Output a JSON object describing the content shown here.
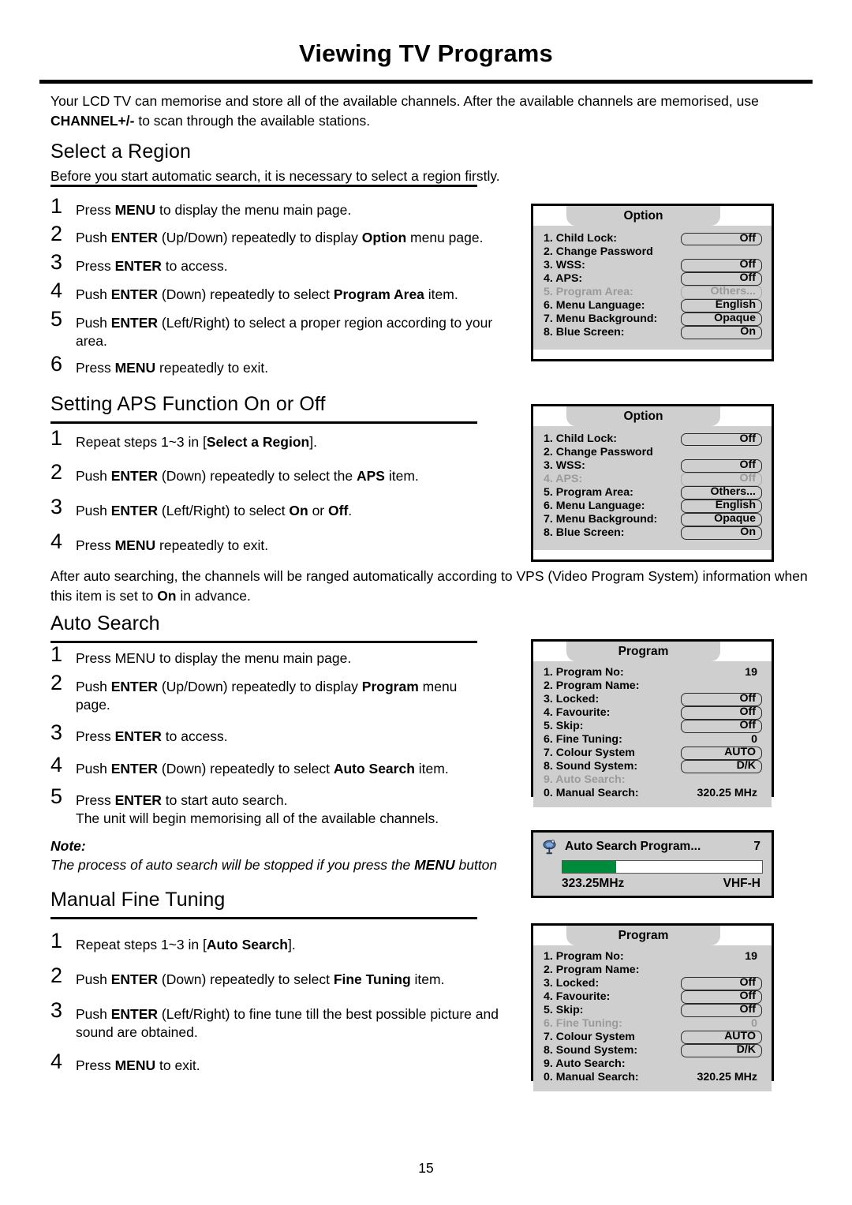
{
  "document": {
    "title": "Viewing TV Programs",
    "page_number": "15",
    "intro_html": "Your LCD TV can memorise and store all of the available channels. After the available channels are memorised, use <b>CHANNEL+/-</b> to scan through the available stations."
  },
  "sections": {
    "select_region": {
      "heading": "Select a Region",
      "subtitle": "Before you start automatic search, it is necessary to select a region firstly.",
      "steps": [
        {
          "num": "1",
          "html": "Press <b>MENU</b> to display the menu main page."
        },
        {
          "num": "2",
          "html": "Push <b>ENTER</b> (Up/Down)  repeatedly to display <b>Option</b> menu page."
        },
        {
          "num": "3",
          "html": "Press <b>ENTER</b> to access."
        },
        {
          "num": "4",
          "html": "Push <b>ENTER</b> (Down) repeatedly to select <b>Program Area</b> item."
        },
        {
          "num": "5",
          "html": "Push <b>ENTER</b> (Left/Right) to select a proper region according to your area."
        },
        {
          "num": "6",
          "html": "Press <b>MENU</b> repeatedly to exit."
        }
      ]
    },
    "aps": {
      "heading": "Setting APS Function On or Off",
      "steps": [
        {
          "num": "1",
          "html": "Repeat steps 1~3 in [<b>Select a Region</b>]."
        },
        {
          "num": "2",
          "html": "Push <b>ENTER</b> (Down) repeatedly to select the <b>APS</b> item."
        },
        {
          "num": "3",
          "html": "Push <b>ENTER</b> (Left/Right) to select <b>On</b> or <b>Off</b>."
        },
        {
          "num": "4",
          "html": "Press <b>MENU</b> repeatedly to exit."
        }
      ],
      "after_paragraph_html": "After auto searching, the channels will be ranged automatically according to VPS (Video Program System) information when this item is set to <b>On</b> in advance."
    },
    "auto_search": {
      "heading": "Auto Search",
      "steps": [
        {
          "num": "1",
          "html": "Press MENU to display the menu main page."
        },
        {
          "num": "2",
          "html": "Push <b>ENTER</b> (Up/Down) repeatedly to display <b>Program</b> menu page."
        },
        {
          "num": "3",
          "html": "Press <b>ENTER</b> to access."
        },
        {
          "num": "4",
          "html": "Push <b>ENTER</b> (Down) repeatedly to select <b>Auto Search</b> item."
        },
        {
          "num": "5",
          "html": "Press <b>ENTER</b> to start auto search.<br>The unit will begin memorising all of the available channels."
        }
      ],
      "note_label": "Note:",
      "note_html": "The process of auto search will be stopped if you press the <b>MENU</b> button"
    },
    "manual_fine_tuning": {
      "heading": "Manual Fine Tuning",
      "steps": [
        {
          "num": "1",
          "html": "Repeat steps 1~3 in [<b>Auto Search</b>]."
        },
        {
          "num": "2",
          "html": "Push <b>ENTER</b> (Down) repeatedly to select <b>Fine Tuning</b> item."
        },
        {
          "num": "3",
          "html": "Push <b>ENTER</b> (Left/Right) to fine tune till the best possible picture and sound are obtained."
        },
        {
          "num": "4",
          "html": "Press <b>MENU</b> to exit."
        }
      ]
    }
  },
  "osd": {
    "option_menu_1": {
      "title": "Option",
      "rows": [
        {
          "label": "1. Child Lock:",
          "value": "Off",
          "field": true,
          "dim": false
        },
        {
          "label": "2. Change Password",
          "value": "",
          "field": false,
          "dim": false
        },
        {
          "label": "3. WSS:",
          "value": "Off",
          "field": true,
          "dim": false
        },
        {
          "label": "4. APS:",
          "value": "Off",
          "field": true,
          "dim": false
        },
        {
          "label": "5. Program Area:",
          "value": "Others...",
          "field": true,
          "dim": true
        },
        {
          "label": "6. Menu Language:",
          "value": "English",
          "field": true,
          "dim": false
        },
        {
          "label": "7. Menu Background:",
          "value": "Opaque",
          "field": true,
          "dim": false
        },
        {
          "label": "8. Blue Screen:",
          "value": "On",
          "field": true,
          "dim": false
        }
      ]
    },
    "option_menu_2": {
      "title": "Option",
      "rows": [
        {
          "label": "1. Child Lock:",
          "value": "Off",
          "field": true,
          "dim": false
        },
        {
          "label": "2. Change Password",
          "value": "",
          "field": false,
          "dim": false
        },
        {
          "label": "3. WSS:",
          "value": "Off",
          "field": true,
          "dim": false
        },
        {
          "label": "4. APS:",
          "value": "Off",
          "field": true,
          "dim": true
        },
        {
          "label": "5. Program Area:",
          "value": "Others...",
          "field": true,
          "dim": false
        },
        {
          "label": "6. Menu Language:",
          "value": "English",
          "field": true,
          "dim": false
        },
        {
          "label": "7. Menu Background:",
          "value": "Opaque",
          "field": true,
          "dim": false
        },
        {
          "label": "8. Blue Screen:",
          "value": "On",
          "field": true,
          "dim": false
        }
      ]
    },
    "program_menu_1": {
      "title": "Program",
      "rows": [
        {
          "label": "1. Program No:",
          "value": "19",
          "field": false,
          "dim": false
        },
        {
          "label": "2. Program Name:",
          "value": "",
          "field": false,
          "dim": false
        },
        {
          "label": "3. Locked:",
          "value": "Off",
          "field": true,
          "dim": false
        },
        {
          "label": "4. Favourite:",
          "value": "Off",
          "field": true,
          "dim": false
        },
        {
          "label": "5. Skip:",
          "value": "Off",
          "field": true,
          "dim": false
        },
        {
          "label": "6. Fine Tuning:",
          "value": "0",
          "field": false,
          "dim": false
        },
        {
          "label": "7. Colour System",
          "value": "AUTO",
          "field": true,
          "dim": false
        },
        {
          "label": "8. Sound System:",
          "value": "D/K",
          "field": true,
          "dim": false
        },
        {
          "label": "9. Auto Search:",
          "value": "",
          "field": false,
          "dim": true
        },
        {
          "label": "0. Manual Search:",
          "value": "320.25 MHz",
          "field": false,
          "dim": false
        }
      ]
    },
    "program_menu_2": {
      "title": "Program",
      "rows": [
        {
          "label": "1. Program No:",
          "value": "19",
          "field": false,
          "dim": false
        },
        {
          "label": "2. Program Name:",
          "value": "",
          "field": false,
          "dim": false
        },
        {
          "label": "3. Locked:",
          "value": "Off",
          "field": true,
          "dim": false
        },
        {
          "label": "4. Favourite:",
          "value": "Off",
          "field": true,
          "dim": false
        },
        {
          "label": "5. Skip:",
          "value": "Off",
          "field": true,
          "dim": false
        },
        {
          "label": "6. Fine Tuning:",
          "value": "0",
          "field": false,
          "dim": true
        },
        {
          "label": "7. Colour System",
          "value": "AUTO",
          "field": true,
          "dim": false
        },
        {
          "label": "8. Sound System:",
          "value": "D/K",
          "field": true,
          "dim": false
        },
        {
          "label": "9. Auto Search:",
          "value": "",
          "field": false,
          "dim": false
        },
        {
          "label": "0. Manual Search:",
          "value": "320.25 MHz",
          "field": false,
          "dim": false
        }
      ]
    },
    "auto_search_progress": {
      "icon": "satellite-dish-icon",
      "title": "Auto Search Program...",
      "count": "7",
      "progress_percent": 27,
      "frequency": "323.25MHz",
      "band": "VHF-H",
      "bar_color": "#008a3c"
    }
  }
}
